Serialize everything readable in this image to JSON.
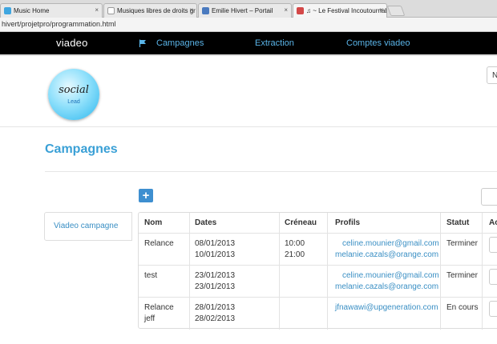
{
  "browser": {
    "tabs": [
      {
        "title": "Music Home",
        "fav_color": "#3fa6e0",
        "active": false
      },
      {
        "title": "Musiques libres de droits gr",
        "fav_color": "#9a9a9a",
        "active": false
      },
      {
        "title": "Emilie Hivert – Portail",
        "fav_color": "#4a7abf",
        "active": false
      },
      {
        "title": "♫ ~ Le Festival Incoutournable",
        "fav_color": "#d44848",
        "active": true
      }
    ],
    "close_glyph": "×",
    "url": "hivert/projetpro/programmation.html"
  },
  "navbar": {
    "brand_main": "viadeo",
    "brand_dot": "",
    "links": [
      "Campagnes",
      "Extraction",
      "Comptes viadeo"
    ],
    "accent_color": "#5ab4e8"
  },
  "header": {
    "logo_text": "social",
    "logo_sub": "Lead",
    "top_button_label": "N"
  },
  "page": {
    "title": "Campagnes"
  },
  "sidebar": {
    "items": [
      "Viadeo campagne"
    ]
  },
  "toolbar": {
    "add_label": "+"
  },
  "table": {
    "headers": [
      "Nom",
      "Dates",
      "Créneau",
      "Profils",
      "Statut",
      "Ac"
    ],
    "rows": [
      {
        "nom": [
          "Relance",
          ""
        ],
        "dates": [
          "08/01/2013",
          "10/01/2013"
        ],
        "creneau": [
          "10:00",
          "21:00"
        ],
        "profils": [
          "celine.mounier@gmail.com",
          "melanie.cazals@orange.com"
        ],
        "statut": "Terminer"
      },
      {
        "nom": [
          "test",
          ""
        ],
        "dates": [
          "23/01/2013",
          "23/01/2013"
        ],
        "creneau": [
          "",
          ""
        ],
        "profils": [
          "celine.mounier@gmail.com",
          "melanie.cazals@orange.com"
        ],
        "statut": "Terminer"
      },
      {
        "nom": [
          "Relance",
          "jeff"
        ],
        "dates": [
          "28/01/2013",
          "28/02/2013"
        ],
        "creneau": [
          "",
          ""
        ],
        "profils": [
          "jfnawawi@upgeneration.com",
          ""
        ],
        "statut": "En cours"
      }
    ]
  }
}
